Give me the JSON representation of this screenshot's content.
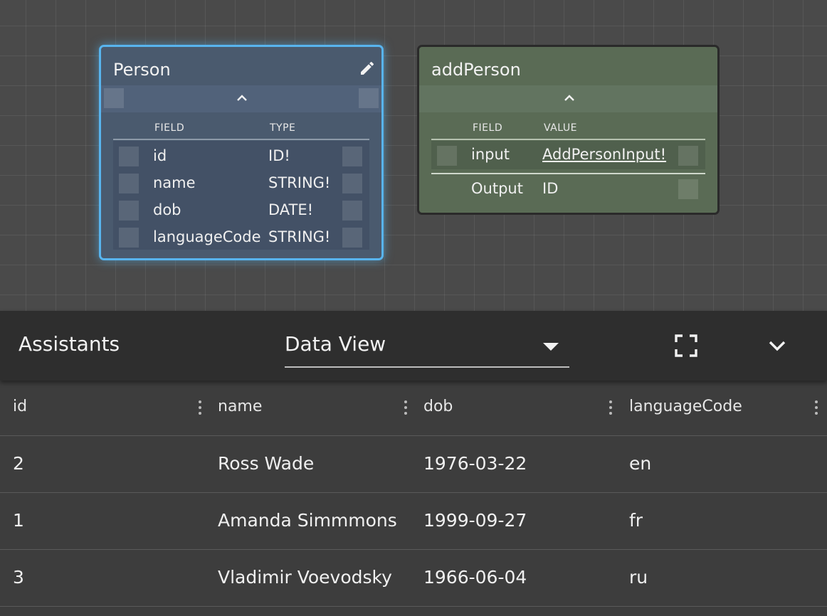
{
  "canvas": {
    "person_node": {
      "title": "Person",
      "col_field": "FIELD",
      "col_type": "TYPE",
      "fields": [
        {
          "name": "id",
          "type": "ID!"
        },
        {
          "name": "name",
          "type": "STRING!"
        },
        {
          "name": "dob",
          "type": "DATE!"
        },
        {
          "name": "languageCode",
          "type": "STRING!"
        }
      ]
    },
    "add_node": {
      "title": "addPerson",
      "col_field": "FIELD",
      "col_value": "VALUE",
      "input_field": "input",
      "input_value": "AddPersonInput!",
      "output_label": "Output",
      "output_value": "ID"
    }
  },
  "panel": {
    "title": "Assistants",
    "view_select": "Data View",
    "icons": [
      "fullscreen-icon",
      "chevron-down-icon"
    ]
  },
  "table": {
    "columns": [
      "id",
      "name",
      "dob",
      "languageCode"
    ],
    "rows": [
      [
        "2",
        "Ross Wade",
        "1976-03-22",
        "en"
      ],
      [
        "1",
        "Amanda Simmmons",
        "1999-09-27",
        "fr"
      ],
      [
        "3",
        "Vladimir Voevodsky",
        "1966-06-04",
        "ru"
      ]
    ]
  },
  "colors": {
    "selected_border": "#58b4ee",
    "person_node_bg": "#4a5a6e",
    "add_node_bg": "#5a6b55"
  }
}
